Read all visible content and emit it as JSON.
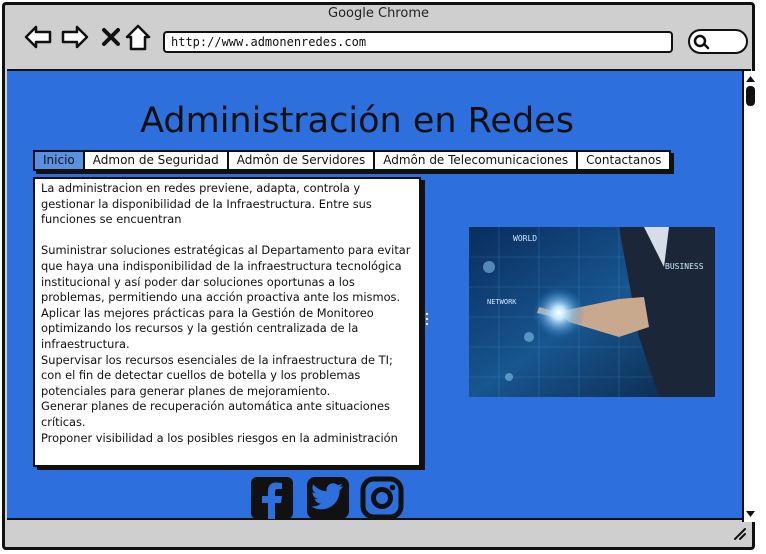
{
  "browser": {
    "title": "Google Chrome",
    "url": "http://www.admonenredes.com"
  },
  "page": {
    "title": "Administración en Redes",
    "menu": [
      {
        "label": "Inicio",
        "active": true
      },
      {
        "label": "Admon de Seguridad",
        "active": false
      },
      {
        "label": "Admôn de Servidores",
        "active": false
      },
      {
        "label": "Admôn de Telecomunicaciones",
        "active": false
      },
      {
        "label": "Contactanos",
        "active": false
      }
    ],
    "body_text": "La administracion en redes previene, adapta, controla y gestionar la disponibilidad de la Infraestructura. Entre sus funciones se encuentran\n\nSuministrar soluciones estratégicas al Departamento para evitar que haya una indisponibilidad de la infraestructura tecnológica institucional y así poder dar soluciones oportunas a los problemas, permitiendo una acción proactiva ante los mismos.\nAplicar las mejores prácticas para la Gestión de Monitoreo optimizando los recursos y la gestión centralizada de la infraestructura.\nSupervisar los recursos esenciales de la infraestructura de TI; con el fin de detectar cuellos de botella y los problemas potenciales para generar planes de mejoramiento.\nGenerar planes de recuperación automática ante situaciones críticas.\nProponer visibilidad a los posibles riesgos en la administración",
    "image_labels": [
      "WORLD",
      "BUSINESS",
      "NETWORK"
    ],
    "social_icons": [
      "facebook-icon",
      "twitter-icon",
      "instagram-icon"
    ]
  },
  "colors": {
    "page_background": "#2d6fdc",
    "active_menu": "#5b8fe0",
    "frame": "#cfcfcf"
  }
}
